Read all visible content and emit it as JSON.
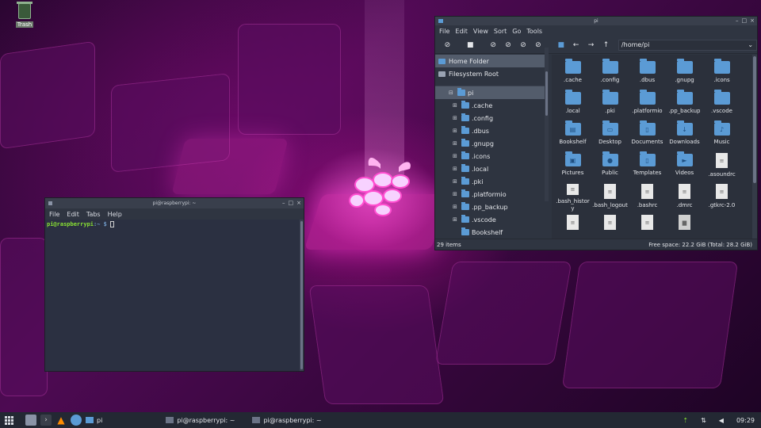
{
  "desktop": {
    "trash_label": "Trash"
  },
  "terminal": {
    "title": "pi@raspberrypi: ~",
    "menu": [
      "File",
      "Edit",
      "Tabs",
      "Help"
    ],
    "prompt_user": "pi@raspberrypi",
    "prompt_path": ":~ $",
    "controls": [
      "–",
      "□",
      "×"
    ]
  },
  "file_manager": {
    "title": "pi",
    "menu": [
      "File",
      "Edit",
      "View",
      "Sort",
      "Go",
      "Tools"
    ],
    "path": "/home/pi",
    "places": [
      "Home Folder",
      "Filesystem Root"
    ],
    "tree_root": "pi",
    "tree_children": [
      ".cache",
      ".config",
      ".dbus",
      ".gnupg",
      ".icons",
      ".local",
      ".pki",
      ".platformio",
      ".pp_backup",
      ".vscode",
      "Bookshelf"
    ],
    "files": [
      {
        "name": ".cache",
        "kind": "folder",
        "icon": ""
      },
      {
        "name": ".config",
        "kind": "folder",
        "icon": ""
      },
      {
        "name": ".dbus",
        "kind": "folder",
        "icon": ""
      },
      {
        "name": ".gnupg",
        "kind": "folder",
        "icon": ""
      },
      {
        "name": ".icons",
        "kind": "folder",
        "icon": ""
      },
      {
        "name": ".local",
        "kind": "folder",
        "icon": ""
      },
      {
        "name": ".pki",
        "kind": "folder",
        "icon": ""
      },
      {
        "name": ".platformio",
        "kind": "folder",
        "icon": ""
      },
      {
        "name": ".pp_backup",
        "kind": "folder",
        "icon": ""
      },
      {
        "name": ".vscode",
        "kind": "folder",
        "icon": ""
      },
      {
        "name": "Bookshelf",
        "kind": "folder",
        "icon": "book-icon"
      },
      {
        "name": "Desktop",
        "kind": "folder",
        "icon": "desktop-icon"
      },
      {
        "name": "Documents",
        "kind": "folder",
        "icon": "document-icon"
      },
      {
        "name": "Downloads",
        "kind": "folder",
        "icon": "download-icon"
      },
      {
        "name": "Music",
        "kind": "folder",
        "icon": "music-icon"
      },
      {
        "name": "Pictures",
        "kind": "folder",
        "icon": "picture-icon"
      },
      {
        "name": "Public",
        "kind": "folder",
        "icon": "user-icon"
      },
      {
        "name": "Templates",
        "kind": "folder",
        "icon": "template-icon"
      },
      {
        "name": "Videos",
        "kind": "folder",
        "icon": "video-icon"
      },
      {
        "name": ".asoundrc",
        "kind": "file",
        "icon": ""
      },
      {
        "name": ".bash_history",
        "kind": "file",
        "icon": ""
      },
      {
        "name": ".bash_logout",
        "kind": "file",
        "icon": ""
      },
      {
        "name": ".bashrc",
        "kind": "file",
        "icon": ""
      },
      {
        "name": ".dmrc",
        "kind": "file",
        "icon": ""
      },
      {
        "name": ".gtkrc-2.0",
        "kind": "file",
        "icon": ""
      },
      {
        "name": "",
        "kind": "file",
        "icon": ""
      },
      {
        "name": "",
        "kind": "file",
        "icon": ""
      },
      {
        "name": "",
        "kind": "file",
        "icon": ""
      },
      {
        "name": "",
        "kind": "file-dark",
        "icon": ""
      }
    ],
    "status_items": "29 items",
    "status_space": "Free space: 22.2 GiB (Total: 28.2 GiB)"
  },
  "taskbar": {
    "quicklaunch": [
      "file-manager-icon",
      "terminal-icon",
      "vlc-icon",
      "browser-icon"
    ],
    "tasks": [
      {
        "label": "pi",
        "icon": "folder-icon"
      },
      {
        "label": "pi@raspberrypi: ~",
        "icon": "terminal-icon"
      },
      {
        "label": "pi@raspberrypi: ~",
        "icon": "terminal-icon"
      }
    ],
    "clock": "09:29"
  },
  "colors": {
    "accent": "#5b9bd5",
    "window_bg": "#2e3440",
    "taskbar_bg": "#232833"
  }
}
